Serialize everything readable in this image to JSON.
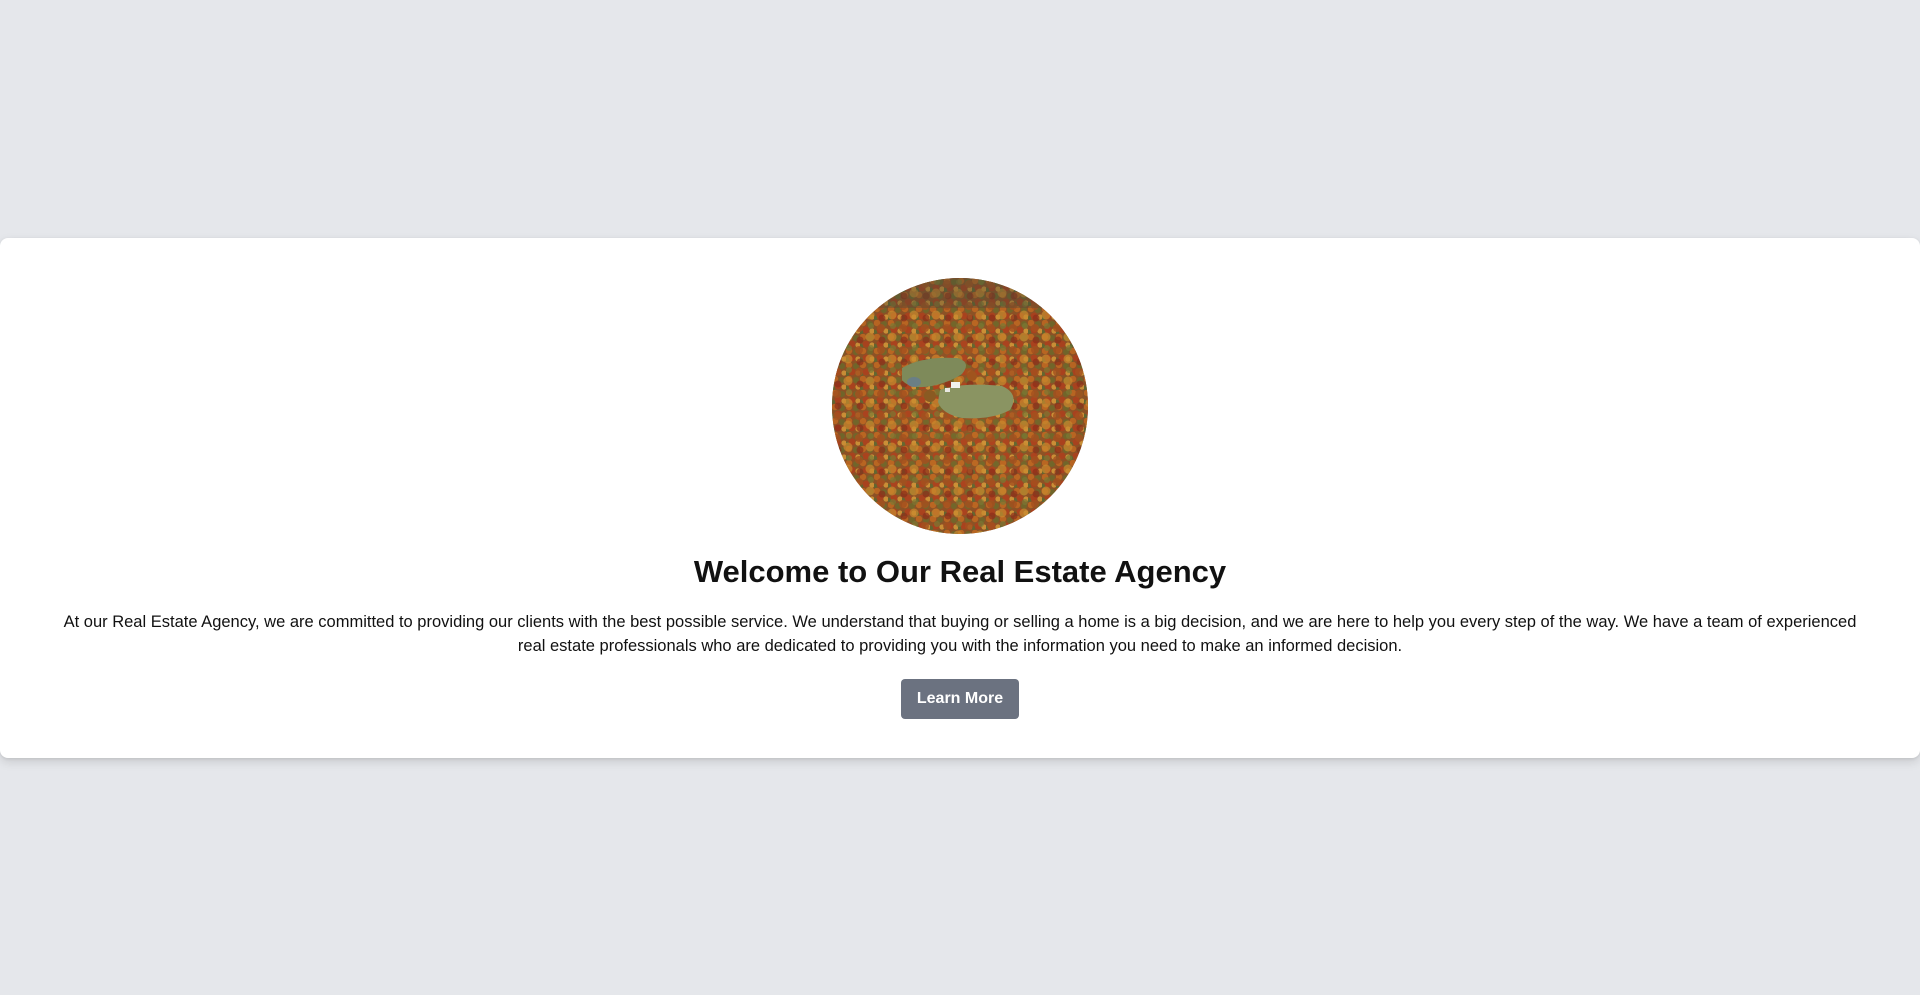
{
  "hero": {
    "image_alt": "Aerial view of autumn forest with a clearing and a house",
    "title": "Welcome to Our Real Estate Agency",
    "description": "At our Real Estate Agency, we are committed to providing our clients with the best possible service. We understand that buying or selling a home is a big decision, and we are here to help you every step of the way. We have a team of experienced real estate professionals who are dedicated to providing you with the information you need to make an informed decision.",
    "button_label": "Learn More"
  },
  "colors": {
    "page_background": "#e5e7eb",
    "card_background": "#ffffff",
    "button_background": "#6b7280",
    "button_text": "#ffffff",
    "text": "#111111"
  }
}
